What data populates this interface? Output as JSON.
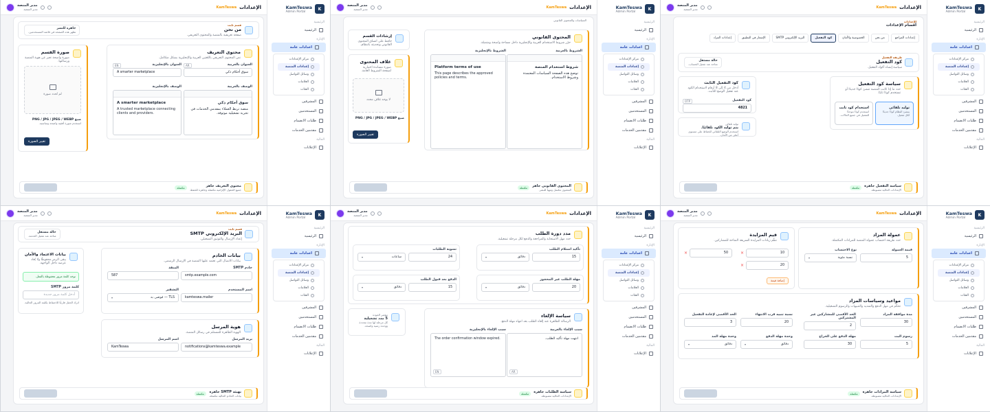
{
  "brand": {
    "name": "KamTeswa",
    "sub": "Admin Portal"
  },
  "topbar": {
    "title": "الإعدادات",
    "crumb": "KamTeswa",
    "user_name": "مدير المنصة",
    "user_role": "مدير المنصة"
  },
  "sidebar": {
    "section_main": "الرئيسية",
    "home": "الرئيسية",
    "section_admin": "الإدارة",
    "settings": "اعدادات عامة",
    "sub_items": [
      "مركز الإعدادات",
      "إعدادات المنصة",
      "وسائل التواصل",
      "العلامات",
      "الفئات"
    ],
    "items": [
      "المشرفين",
      "المستخدمين",
      "طلبات الانضمام",
      "مقدمين الخدمات"
    ],
    "section_finance": "المالية",
    "finance_item": "الإعلانات"
  },
  "t1": {
    "pill_title": "قسم ثابت",
    "pill_value": "من نحن",
    "pill_sub": "صفحة تعريفية بالمنصة والمحتوى التعريفي.",
    "ready_title": "جاهزة للنشر",
    "ready_sub": "تظهر هذه الصفحة في قائمة المستخدمين.",
    "card_title": "محتوى التعريف",
    "card_desc": "نص المحتوى التعريفي باللغتين العربية والإنجليزية بشكل متكامل.",
    "title_ar_label": "العنوان بالعربية",
    "title_ar": "سوق أحكام ذكي",
    "title_en_label": "العنوان بالإنجليزية",
    "title_en": "A smarter marketplace",
    "desc_ar_label": "الوصف بالعربية",
    "desc_ar_h": "سوق أحكام ذكي",
    "desc_ar_body": "منصة تربط العملاء بمقدمي الخدمات في تجربة تشغيلية موثوقة.",
    "desc_en_label": "الوصف بالإنجليزية",
    "desc_en_h": "A smarter marketplace",
    "desc_en_body": "A trusted marketplace connecting clients and providers.",
    "image_title": "صورة القسم",
    "image_desc": "صورة واضحة تعبر عن هوية المنصة ورسالتها.",
    "no_image": "لم تُحدد صورة",
    "image_hint": "صيغ PNG / JPG / JPEG / WEBP",
    "image_hint2": "استخدم صورة أفقية واضحة ومناسبة.",
    "upload_btn": "تغيير الصورة",
    "footer_title": "محتوى التعريف جاهز",
    "footer_sub": "جميع الحقول الإلزامية مكتملة وجاهزة للحفظ.",
    "badge": "مكتملة",
    "tag_ar": "AR",
    "tag_en": "EN"
  },
  "t2": {
    "card_title": "المحتوى القانوني",
    "card_desc": "حرّر شروط الاستخدام العربية والإنجليزية داخل مساحة واضحة ومتصلة.",
    "ar_label": "الشروط بالعربية",
    "en_label": "الشروط بالإنجليزية",
    "ar_h": "شروط استخدام المنصة",
    "ar_body": "توضح هذه الصفحة السياسات المعتمدة وشروط الاستخدام.",
    "en_h": "Platform terms of use",
    "en_body": "This page describes the approved policies and terms.",
    "side_title": "إرشادات القسم",
    "side_desc": "حافظ على اتساق المحتوى القانوني وتحديثه بانتظام.",
    "cover_title": "غلاف المحتوى",
    "cover_desc": "صورة مساندة اختيارية لصفحة الشروط العامة.",
    "no_cover": "لا يوجد غلاف محدد",
    "cover_hint": "صيغ PNG / JPG / JPEG / WEBP",
    "upload_btn": "تغيير الصورة",
    "footer_title": "المحتوى القانوني جاهز",
    "footer_sub": "المحتوى مكتمل ومهيأ للنشر.",
    "badge": "مكتملة",
    "top_note": "السياسات والمحتوى القانوني"
  },
  "t3": {
    "crumb_small": "الإعدادات",
    "page_title": "أقسام الإعدادات",
    "tabs": [
      "إعدادات المراجع",
      "من نحن",
      "الخصوصية والأمان",
      "كود التفعيل",
      "البريد الإلكتروني SMTP",
      "الإشعار في التطبيق",
      "إعدادات المزاد"
    ],
    "code_title": "كود التفعيل",
    "code_desc": "سياسة إنشاء أكواد التفعيل.",
    "code_pill_title": "طريقة التفعيل",
    "code_pill": "تلقائي",
    "code_pill_sub": "نظام التفعيل للمستخدمين الجدد.",
    "status_title": "حالة مستقل",
    "status_sub": "متاحة عند تفعيل الحساب.",
    "policy_title": "سياسة كود التفعيل",
    "policy_desc": "حدد ما إذا كانت المنصة تنشئ كودًا جديدًا أو تستخدم كودًا ثابتًا.",
    "opt1_title": "توليد تلقائي",
    "opt1_desc": "ينشئ النظام كودًا جديدًا لكل تفعيل.",
    "opt2_title": "استخدام كود ثابت",
    "opt2_desc": "استخدم كودًا موحدًا للتفعيل في جميع الحالات.",
    "fixed_title": "كود التفعيل الثابت",
    "fixed_desc": "أدخل من 4 إلى 8 أرقام لاستخدام الكود عند تفعيل الوضع الثابت.",
    "fixed_label": "كود التفعيل",
    "fixed_value": "4821",
    "fixed_tag": "OTP",
    "auto_title": "توليد تلقائي",
    "auto_line": "يتم توليد الكود تلقائيًا.",
    "auto_desc": "استخدم الوضع التلقائي للحفاظ على مستوى أعلى من الأمان.",
    "footer_title": "سياسة التفعيل جاهزة",
    "footer_sub": "الإعدادات الحالية مضبوطة.",
    "badge": "مكتملة"
  },
  "t4": {
    "crumb_small": "قسم ثابت",
    "title": "البريد الإلكتروني SMTP",
    "desc": "إعداد الإرسال والتوثيق التشغيلي.",
    "status_title": "حالة مستقل",
    "status_sub": "متاحة عند تفعيل الخدمة.",
    "server_title": "بيانات الخادم",
    "server_desc": "بيانات الاتصال التي تعتمد عليها المنصة في الإرسال الرسمي.",
    "host_label": "خادم SMTP",
    "host": "smtp.example.com",
    "port_label": "المنفذ",
    "port": "587",
    "user_label": "اسم المستخدم",
    "user": "kamteswa.mailer",
    "enc_label": "التشفير",
    "enc": "TLS — مُوصى به",
    "cred_title": "بيانات الاعتماد والأمان",
    "cred_desc": "يبقى الرمز محفوظًا ولا يُعاد عرضه داخل الواجهة.",
    "pwd_ok": "توجد كلمة مرور محفوظة بالفعل.",
    "pwd_label": "كلمة مرور SMTP",
    "pwd_placeholder": "أدخل كلمة مرور جديدة",
    "pwd_note": "اترك الحقل فارغًا للاحتفاظ بكلمة المرور الحالية.",
    "sender_title": "هوية المرسل",
    "sender_desc": "الهوية الظاهرة للمستلم في رسائل المنصة.",
    "sender_email_label": "بريد المرسل",
    "sender_email": "notifications@kamteswa.example",
    "sender_name_label": "اسم المرسل",
    "sender_name": "KamTeswa",
    "footer_title": "تهيئة SMTP جاهزة",
    "footer_sub": "بيانات الخادم الحالية مكتملة.",
    "badge": "مكتملة"
  },
  "t5": {
    "cycle_title": "مدد دورة الطلب",
    "cycle_desc": "حدد مهل الاستجابة والمراجعة والدفع لكل مرحلة تشغيلية.",
    "f1_label": "تأكيد استلام الطلب",
    "f1_val": "15",
    "f1_unit": "دقائق",
    "f2_label": "تسوية الطلبات",
    "f2_val": "24",
    "f2_unit": "ساعات",
    "f3_label": "مهلة الطلب غير المحجوز",
    "f3_val": "20",
    "f3_unit": "دقائق",
    "f4_label": "الدفع بعد قبول الطلب",
    "f4_val": "15",
    "f4_unit": "دقائق",
    "cancel_title": "سياسة الإلغاء",
    "cancel_desc": "الرسالة الظاهرة عند إلغاء الطلب بعد انتهاء مهلة الدفع.",
    "reason_ar_label": "سبب الإلغاء بالعربية",
    "reason_ar": "انتهت مهلة تأكيد الطلب.",
    "reason_en_label": "سبب الإلغاء بالإنجليزية",
    "reason_en": "The order confirmation window expired.",
    "side_small": "مؤشر الجودة",
    "side_title": "5 مدد تشغيلية",
    "side_desc": "كل مرحلة لها مدة محددة ووحدة زمنية واضحة.",
    "footer_title": "سياسة الطلبات جاهزة",
    "footer_sub": "الإعدادات الحالية مضبوطة.",
    "badge": "مكتملة",
    "tag_ar": "AR",
    "tag_en": "EN"
  },
  "t6": {
    "comm_title": "عمولة المزاد",
    "comm_desc": "حدد طريقة احتساب عمولة المنصة للمزادات المكتملة.",
    "type_label": "نوع الاحتساب",
    "type_val": "نسبة مئوية",
    "value_label": "قيمة العمولة",
    "value_val": "5",
    "inc_title": "قيم المزايدة",
    "inc_desc": "نظّم زيادات المزايدة السريعة المتاحة للمشاركين.",
    "inc_vals": [
      "10",
      "20",
      "50"
    ],
    "inc_add": "إضافة قيمة",
    "dates_title": "مواعيد وسياسات المزاد",
    "dates_desc": "تحكّم في مهل الدفع والتمديد والتنبيهات والرسوم التشغيلية.",
    "d1_label": "مدة موافقة المزاد",
    "d1_val": "30",
    "d2_label": "الحد الأقصى للمشاركين غير المشتركين",
    "d2_val": "2",
    "d3_label": "نسبة تنبيه قرب الانتهاء",
    "d3_val": "20",
    "d4_label": "الحد الأقصى لإعادة التفعيل",
    "d4_val": "3",
    "d5_label": "رسوم البث",
    "d5_val": "5",
    "d6_label": "مهلة الدفع على الخراج",
    "d6_val": "30",
    "d7_label": "وحدة مهلة الدفع",
    "d7_val": "دقائق",
    "d8_label": "وحدة مهلة المد",
    "d8_val": "دقائق",
    "footer_title": "سياسة المزادات جاهزة",
    "footer_sub": "الإعدادات الحالية مضبوطة.",
    "badge": "مكتملة"
  }
}
